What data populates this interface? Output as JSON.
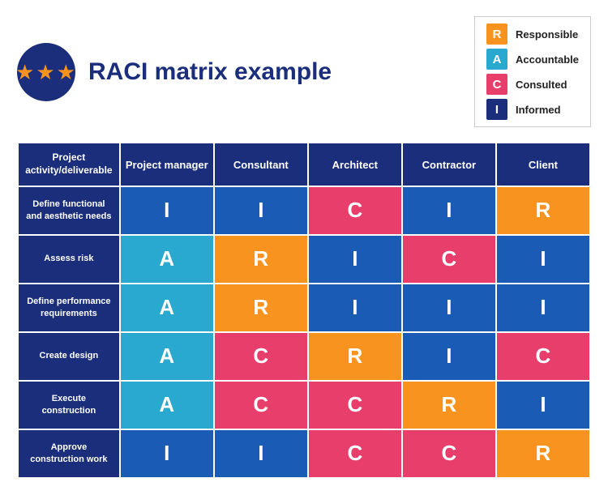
{
  "header": {
    "title": "RACI matrix example",
    "logo_alt": "Star logo"
  },
  "legend": {
    "items": [
      {
        "letter": "R",
        "label": "Responsible",
        "color": "#f7931e"
      },
      {
        "letter": "A",
        "label": "Accountable",
        "color": "#29a8d0"
      },
      {
        "letter": "C",
        "label": "Consulted",
        "color": "#e83e6c"
      },
      {
        "letter": "I",
        "label": "Informed",
        "color": "#1a2e7c"
      }
    ]
  },
  "table": {
    "columns": [
      "Project activity/deliverable",
      "Project manager",
      "Consultant",
      "Architect",
      "Contractor",
      "Client"
    ],
    "rows": [
      {
        "activity": "Define functional and aesthetic needs",
        "cells": [
          "I",
          "I",
          "C",
          "I",
          "R"
        ],
        "colors": [
          "bg-blue",
          "bg-blue",
          "bg-pink",
          "bg-blue",
          "bg-orange"
        ]
      },
      {
        "activity": "Assess risk",
        "cells": [
          "A",
          "R",
          "I",
          "C",
          "I"
        ],
        "colors": [
          "bg-teal",
          "bg-orange",
          "bg-blue",
          "bg-pink",
          "bg-blue"
        ]
      },
      {
        "activity": "Define performance requirements",
        "cells": [
          "A",
          "R",
          "I",
          "I",
          "I"
        ],
        "colors": [
          "bg-teal",
          "bg-orange",
          "bg-blue",
          "bg-blue",
          "bg-blue"
        ]
      },
      {
        "activity": "Create design",
        "cells": [
          "A",
          "C",
          "R",
          "I",
          "C"
        ],
        "colors": [
          "bg-teal",
          "bg-pink",
          "bg-orange",
          "bg-blue",
          "bg-pink"
        ]
      },
      {
        "activity": "Execute construction",
        "cells": [
          "A",
          "C",
          "C",
          "R",
          "I"
        ],
        "colors": [
          "bg-teal",
          "bg-pink",
          "bg-pink",
          "bg-orange",
          "bg-blue"
        ]
      },
      {
        "activity": "Approve construction work",
        "cells": [
          "I",
          "I",
          "C",
          "C",
          "R"
        ],
        "colors": [
          "bg-blue",
          "bg-blue",
          "bg-pink",
          "bg-pink",
          "bg-orange"
        ]
      }
    ]
  }
}
